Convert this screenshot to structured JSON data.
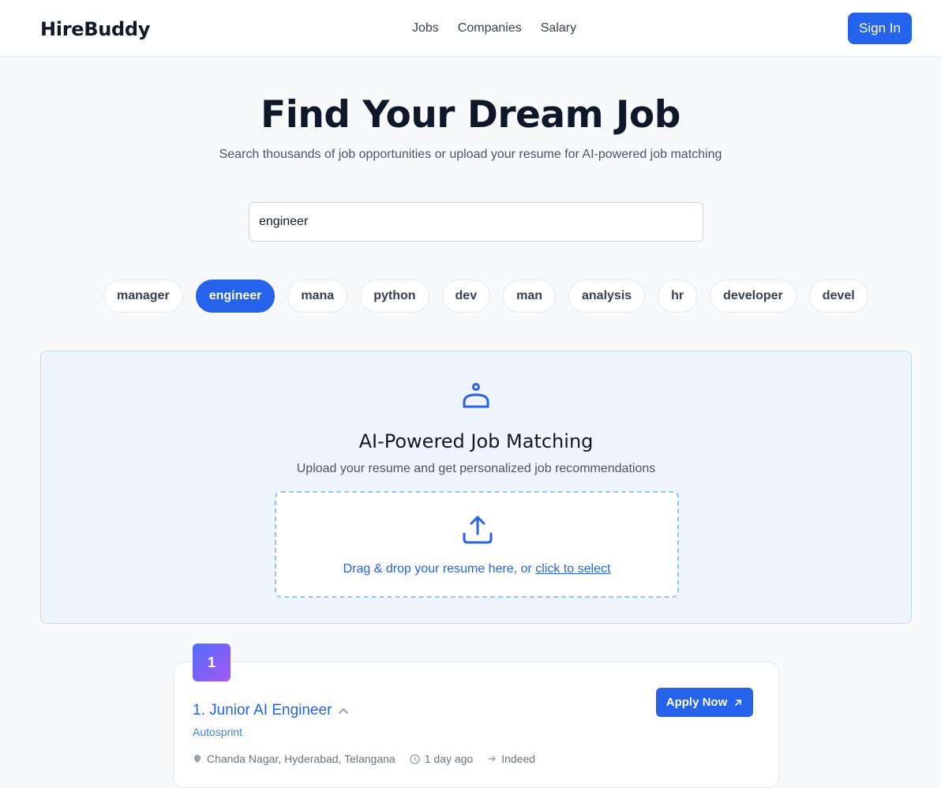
{
  "header": {
    "logo": "HireBuddy",
    "nav": [
      "Jobs",
      "Companies",
      "Salary"
    ],
    "sign_in": "Sign In"
  },
  "hero": {
    "title": "Find Your Dream Job",
    "subtitle": "Search thousands of job opportunities or upload your resume for AI-powered job matching"
  },
  "search": {
    "value": "engineer"
  },
  "chips": {
    "items": [
      "manager",
      "engineer",
      "mana",
      "python",
      "dev",
      "man",
      "analysis",
      "hr",
      "developer",
      "devel"
    ],
    "active": "engineer"
  },
  "ai_matching": {
    "title": "AI-Powered Job Matching",
    "subtitle": "Upload your resume and get personalized job recommendations",
    "drop_text": "Drag & drop your resume here, or ",
    "drop_link": "click to select"
  },
  "jobs": [
    {
      "rank": "1",
      "title": "1. Junior AI Engineer",
      "company": "Autosprint",
      "apply_label": "Apply Now",
      "location": "Chanda Nagar, Hyderabad, Telangana",
      "posted": "1 day ago",
      "source": "Indeed"
    }
  ],
  "colors": {
    "accent": "#2563eb",
    "panel_bg": "#eef5ff",
    "badge_gradient": [
      "#4f6ef7",
      "#a855f7"
    ]
  }
}
